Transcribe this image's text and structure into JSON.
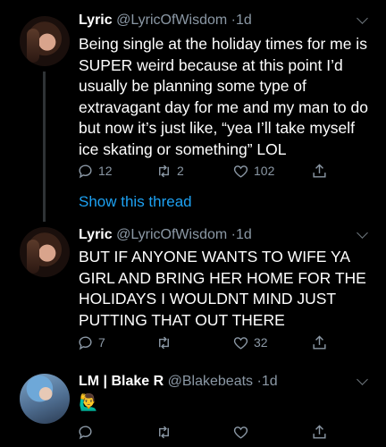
{
  "tweets": [
    {
      "name": "Lyric",
      "handle": "@LyricOfWisdom",
      "dot": "·",
      "time": "1d",
      "text": "Being single at the holiday times for me is SUPER weird because at this point I’d usually be planning some type of extravagant day for me and my man to do but now it’s just like, “yea I’ll take myself ice skating or something” LOL",
      "replies": "12",
      "retweets": "2",
      "likes": "102",
      "show_thread": "Show this thread"
    },
    {
      "name": "Lyric",
      "handle": "@LyricOfWisdom",
      "dot": "·",
      "time": "1d",
      "text": "BUT IF ANYONE WANTS TO WIFE YA GIRL AND BRING HER HOME FOR THE HOLIDAYS I WOULDNT MIND JUST PUTTING THAT OUT THERE",
      "replies": "7",
      "retweets": "",
      "likes": "32"
    },
    {
      "name": "LM | Blake R",
      "handle": "@Blakebeats",
      "dot": "·",
      "time": "1d",
      "text": "🙋‍♂️",
      "replies": "",
      "retweets": "",
      "likes": ""
    }
  ],
  "colors": {
    "background": "#000000",
    "muted": "#8b98a5",
    "link": "#1da1f2",
    "thread_line": "#2f3336"
  },
  "icons": [
    "reply-icon",
    "retweet-icon",
    "like-icon",
    "share-icon",
    "caret-down-icon"
  ]
}
